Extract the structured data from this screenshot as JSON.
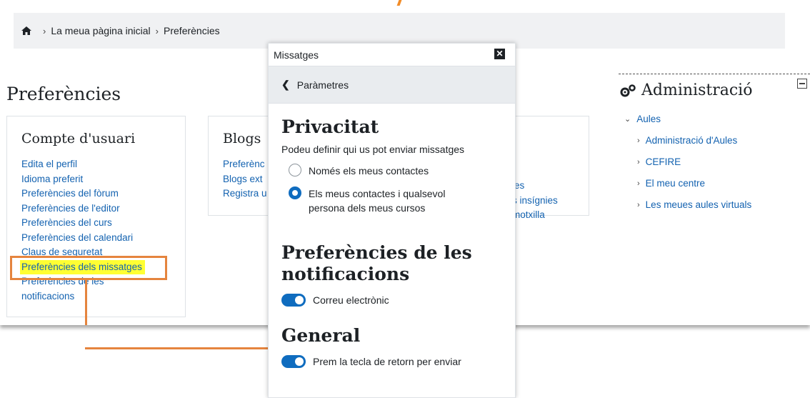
{
  "breadcrumb": {
    "home": "La meua pàgina inicial",
    "current": "Preferències"
  },
  "page": {
    "title": "Preferències"
  },
  "account": {
    "heading": "Compte d'usuari",
    "links": [
      "Edita el perfil",
      "Idioma preferit",
      "Preferències del fòrum",
      "Preferències de l'editor",
      "Preferències del curs",
      "Preferències del calendari",
      "Claus de seguretat",
      "Preferències dels missatges",
      "Preferències de les notificacions"
    ]
  },
  "blogs": {
    "heading": "Blogs",
    "links": [
      "Preferènc",
      "Blogs ext",
      "Registra u"
    ],
    "right_links": [
      "ies",
      "s insígnies",
      "motxilla"
    ]
  },
  "admin": {
    "title": "Administració",
    "root": "Aules",
    "items": [
      "Administració d'Aules",
      "CEFIRE",
      "El meu centre",
      "Les meues aules virtuals"
    ]
  },
  "drawer": {
    "title": "Missatges",
    "back_label": "Paràmetres",
    "privacy_heading": "Privacitat",
    "privacy_desc": "Podeu definir qui us pot enviar missatges",
    "options": [
      {
        "label": "Només els meus contactes",
        "checked": false
      },
      {
        "label": "Els meus contactes i qualsevol persona dels meus cursos",
        "checked": true
      }
    ],
    "notif_heading": "Preferències de les notificacions",
    "email_label": "Correu electrònic",
    "general_heading": "General",
    "enter_label": "Prem la tecla de retorn per enviar"
  },
  "colors": {
    "accent": "#0f6cbf",
    "link": "#1362b0",
    "highlight": "#ffff33",
    "callout": "#e5843e"
  }
}
